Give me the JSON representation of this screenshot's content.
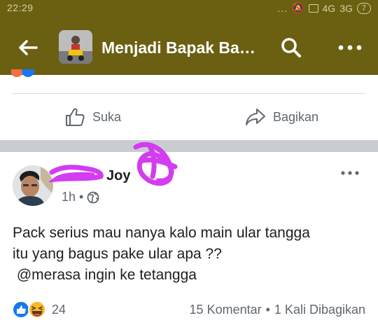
{
  "status_bar": {
    "time": "22:29",
    "signal_dots": "...",
    "network_1": "4G",
    "network_2": "3G",
    "battery": "7"
  },
  "app_bar": {
    "title": "Menjadi Bapak Ba…"
  },
  "prev_post": {
    "like_label": "Suka",
    "share_label": "Bagikan"
  },
  "post": {
    "author_name": "Joy",
    "time_ago": "1h",
    "meta_sep": "•",
    "text_lines": [
      "Pack serius mau nanya kalo main ular tangga",
      "itu yang bagus pake ular apa ??",
      " @merasa ingin ke tetangga"
    ],
    "reaction_count": "24",
    "comments": "15 Komentar",
    "stats_sep": "•",
    "shares": "1 Kali Dibagikan"
  },
  "colors": {
    "header_bg": "#6b5f12",
    "like_blue": "#1877f2",
    "haha_yellow": "#f7b928",
    "scribble": "#d33cf0",
    "separator": "#c9ccd1"
  }
}
